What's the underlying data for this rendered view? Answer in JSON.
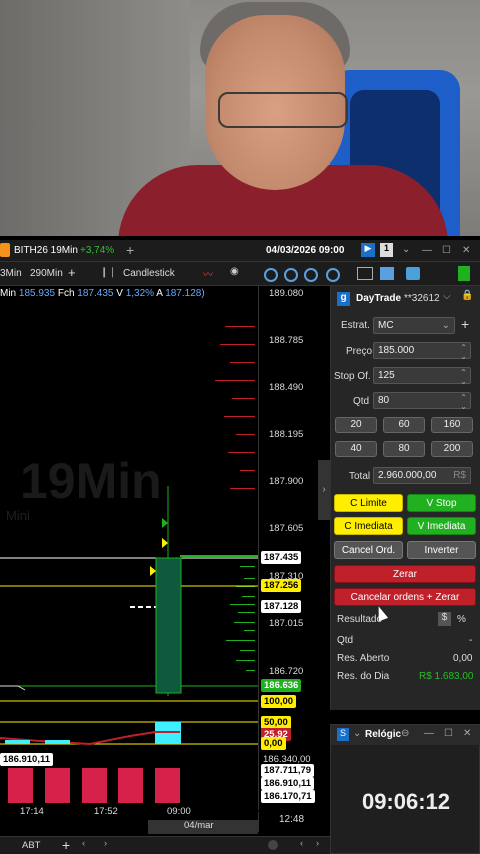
{
  "window": {
    "symbol": "BITH26 19Min",
    "change": "+3,74%",
    "datetime": "04/03/2026 09:00",
    "badge": "1"
  },
  "toolbar": {
    "tf1": "3Min",
    "tf2": "290Min",
    "chart_type": "Candlestick"
  },
  "ohlc": {
    "min_label": "Min",
    "min": "185.935",
    "fch_label": "Fch",
    "fch": "187.435",
    "v_label": "V",
    "v": "1,32%",
    "a_label": "A",
    "a": "187.128)"
  },
  "watermark": {
    "main": "19Min",
    "sub": "Mini"
  },
  "axis": {
    "ticks": [
      "189.080",
      "188.785",
      "188.490",
      "188.195",
      "187.900",
      "187.605",
      "187.310",
      "187.015",
      "186.720"
    ],
    "tags": {
      "last": "187.435",
      "avg": "187.256",
      "cur": "187.128",
      "low": "186.636",
      "v100": "100,00",
      "v50": "50,00",
      "v25": "25,92",
      "v0": "0,00",
      "p1": "186.340,00",
      "p2": "187.711,79",
      "p3": "186.910,11",
      "p4": "186.170,71",
      "p5": "186.910,11"
    },
    "clock_tag": "12:48"
  },
  "xaxis": {
    "t1": "17:14",
    "t2": "17:52",
    "t3": "09:00",
    "date": "04/mar"
  },
  "panel": {
    "account": "DayTrade",
    "account_no": "**32612",
    "estrat_label": "Estrat.",
    "estrat_value": "MC",
    "preco_label": "Preço",
    "preco_value": "185.000",
    "stop_label": "Stop Of.",
    "stop_value": "125",
    "qtd_label": "Qtd",
    "qtd_value": "80",
    "qty_buttons": [
      "20",
      "60",
      "160",
      "40",
      "80",
      "200"
    ],
    "total_label": "Total",
    "total_value": "2.960.000,00",
    "total_unit": "R$",
    "c_limite": "C Limite",
    "v_stop": "V Stop",
    "c_imediata": "C Imediata",
    "v_imediata": "V Imediata",
    "cancel_ord": "Cancel Ord.",
    "inverter": "Inverter",
    "zerar": "Zerar",
    "cancelar_zerar": "Cancelar ordens + Zerar",
    "resultado_label": "Resultado",
    "res_qtd_label": "Qtd",
    "res_qtd_value": "-",
    "res_aberto_label": "Res. Aberto",
    "res_aberto_value": "0,00",
    "res_dia_label": "Res. do Dia",
    "res_dia_value": "R$ 1.683,00",
    "pct_symbol": "%",
    "dollar_symbol": "$"
  },
  "clock": {
    "title": "Relógic",
    "time": "09:06:12"
  },
  "statusbar": {
    "tab": "ABT"
  },
  "colors": {
    "up": "#20b020",
    "down": "#c0202a",
    "yellow": "#ffee00",
    "blue": "#5aa0e0"
  }
}
